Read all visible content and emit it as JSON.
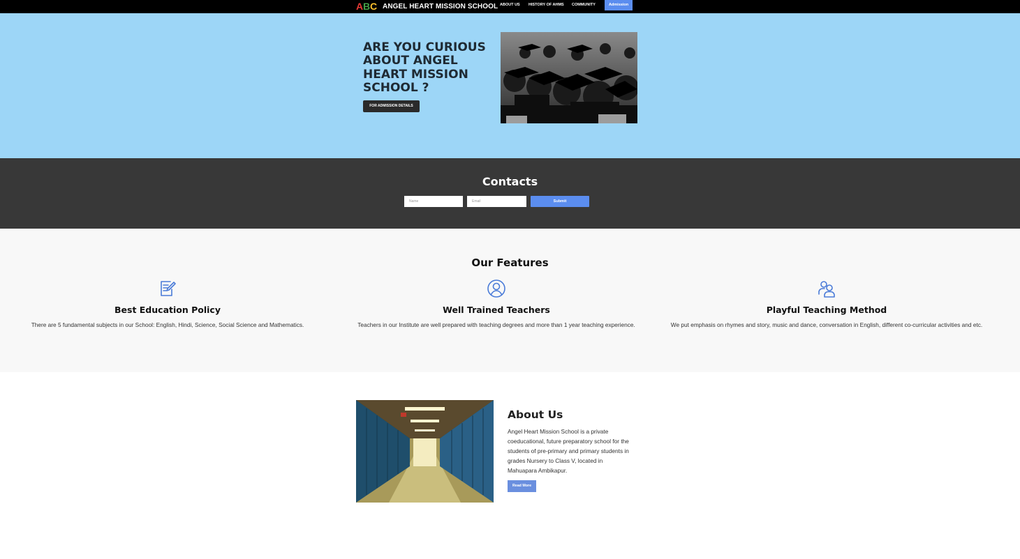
{
  "nav": {
    "logo_letters": [
      "A",
      "B",
      "C"
    ],
    "brand": "ANGEL HEART MISSION SCHOOL",
    "links": [
      "ABOUT US",
      "HISTORY OF AHMS",
      "COMMUNITY"
    ],
    "admission": "Admission"
  },
  "hero": {
    "title": "ARE YOU CURIOUS\nABOUT ANGEL\nHEART MISSION\nSCHOOL ?",
    "button": "FOR ADMISSION DETAILS"
  },
  "contacts": {
    "title": "Contacts",
    "name_placeholder": "Name",
    "email_placeholder": "Email",
    "submit": "Submit"
  },
  "features": {
    "title": "Our Features",
    "items": [
      {
        "icon": "edit-document-icon",
        "title": "Best Education Policy",
        "desc": "There are 5 fundamental subjects in our School: English, Hindi, Science, Social Science and Mathematics."
      },
      {
        "icon": "user-circle-icon",
        "title": "Well Trained Teachers",
        "desc": "Teachers in our Institute are well prepared with teaching degrees and more than 1 year teaching experience."
      },
      {
        "icon": "users-group-icon",
        "title": "Playful Teaching Method",
        "desc": "We put emphasis on rhymes and story, music and dance, conversation in English, different co-curricular activities and etc."
      }
    ]
  },
  "about": {
    "title": "About Us",
    "text": "Angel Heart Mission School is a private coeducational, future preparatory school for the students of pre-primary and primary students in grades Nursery to Class V, located in Mahuapara Ambikapur.",
    "button": "Read More"
  },
  "colors": {
    "nav_bg": "#000000",
    "hero_bg": "#9dd6f7",
    "contacts_bg": "#383838",
    "features_bg": "#f8f8f8",
    "accent": "#5b8def"
  }
}
